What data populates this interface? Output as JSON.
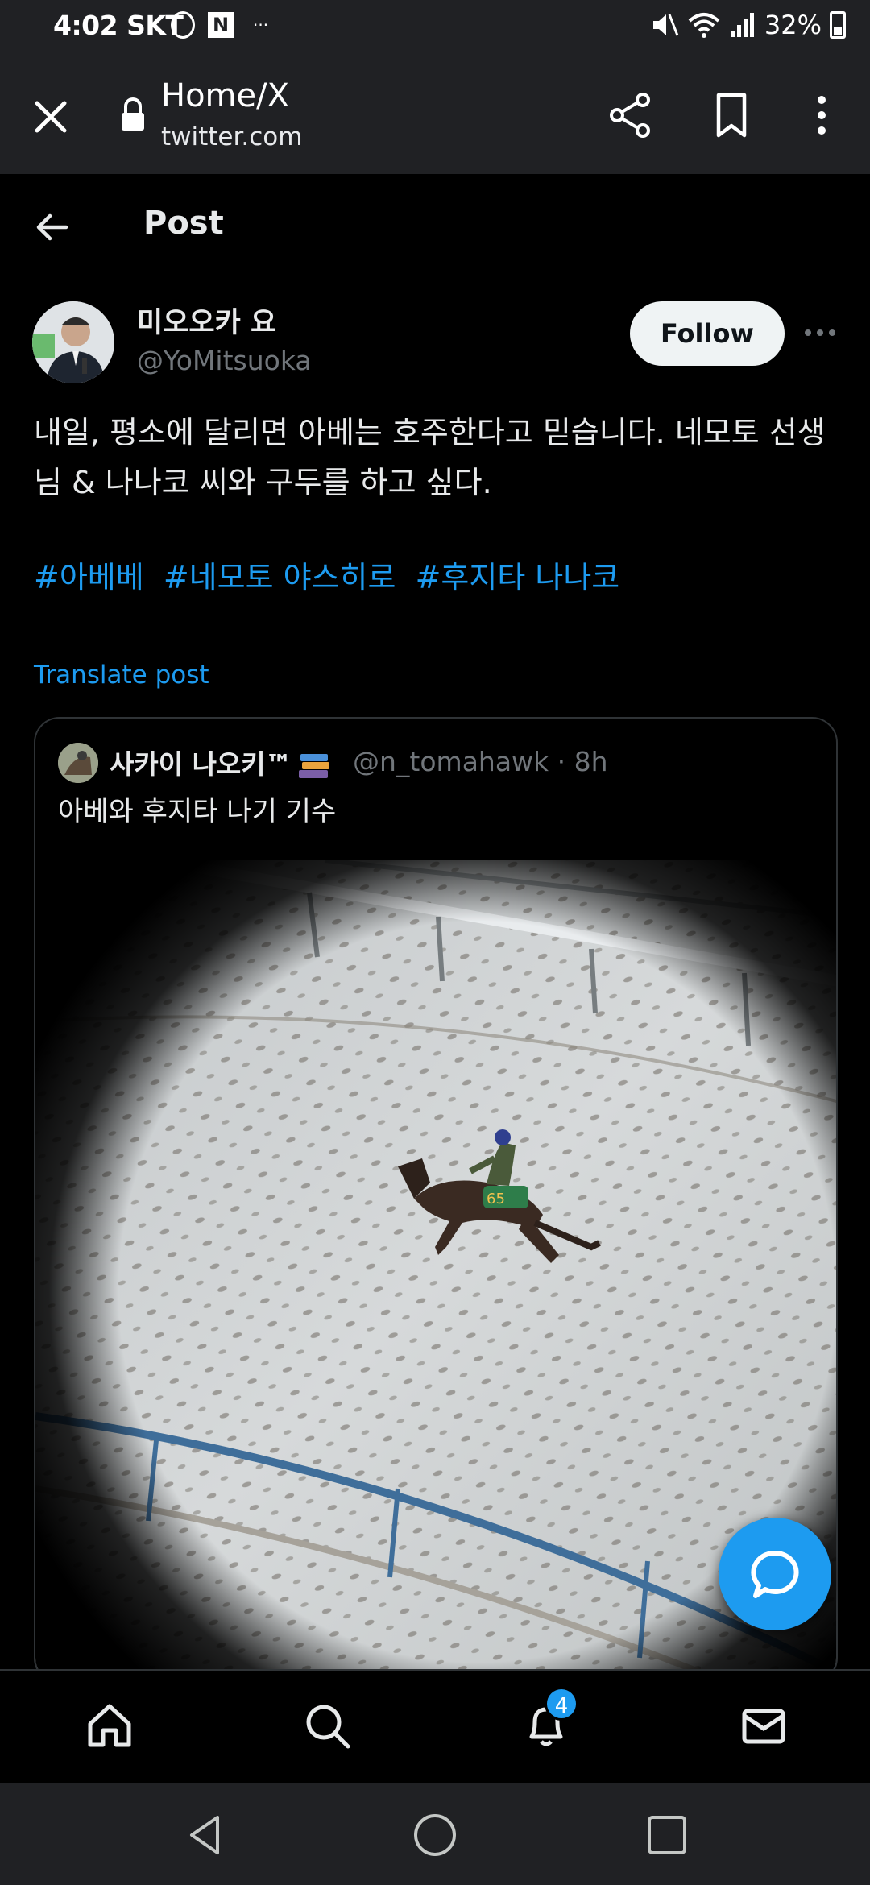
{
  "status_bar": {
    "time": "4:02",
    "carrier": "SKT",
    "notification_badge": "N",
    "overflow": "···",
    "battery": "32%"
  },
  "browser": {
    "page_title": "Home/X",
    "url": "twitter.com"
  },
  "header": {
    "title": "Post"
  },
  "post": {
    "author_name": "미오오카 요",
    "author_handle": "@YoMitsuoka",
    "follow_label": "Follow",
    "text": "내일, 평소에 달리면 아베는 호주한다고 믿습니다. 네모토 선생님 & 나나코 씨와 구두를 하고 싶다.",
    "hashtags": [
      "#아베베",
      "#네모토 야스히로",
      "#후지타 나나코"
    ],
    "translate_label": "Translate post"
  },
  "quote": {
    "author_name": "사카이 나오키™",
    "handle_time": "@n_tomahawk · 8h",
    "text": "아베와 후지타 나기 기수",
    "saddle_number": "65"
  },
  "bottom_nav": {
    "items": [
      "home-icon",
      "search-icon",
      "bell-icon",
      "mail-icon"
    ],
    "notification_count": "4"
  },
  "colors": {
    "accent": "#1d9bf0",
    "background": "#000000",
    "chrome": "#202124",
    "secondary_text": "#71767b"
  }
}
